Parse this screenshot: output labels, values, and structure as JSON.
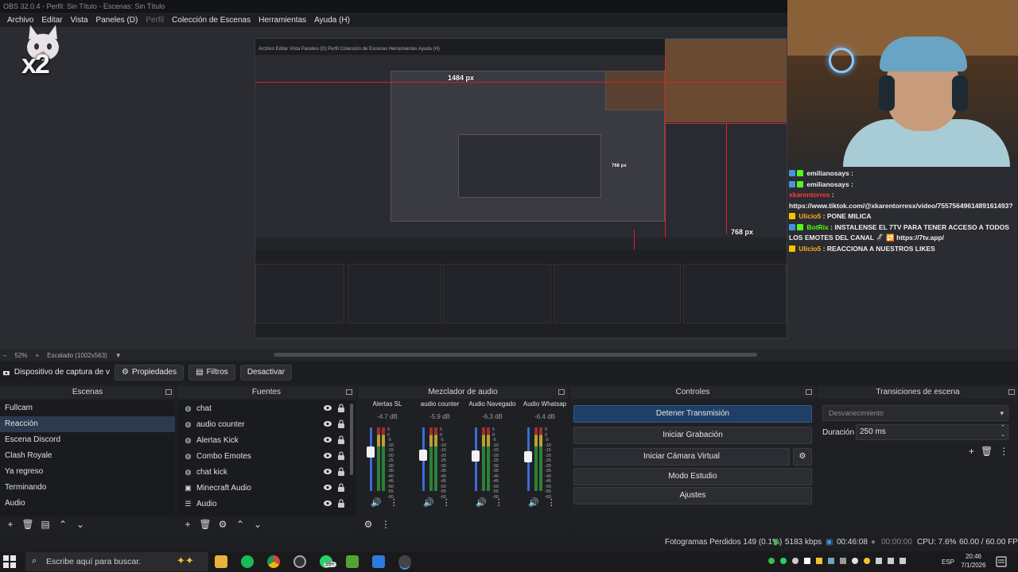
{
  "window": {
    "title": "OBS 32.0.4 - Perfil: Sin Título - Escenas: Sin Título"
  },
  "menu": [
    "Archivo",
    "Editar",
    "Vista",
    "Paneles (D)",
    "Perfil",
    "Colección de Escenas",
    "Herramientas",
    "Ayuda (H)"
  ],
  "overlay": {
    "multiplier": "x2"
  },
  "preview": {
    "labels": {
      "width": "1484 px",
      "height_top": "768 px",
      "height_bottom": "768 px"
    }
  },
  "chat": {
    "lines": [
      {
        "user": "emilianosays",
        "text": ""
      },
      {
        "user": "emilianosays",
        "text": ""
      },
      {
        "user": "xkarentorres",
        "text": "https://www.tiktok.com/@xkarentorresx/video/7557564961489161493?"
      },
      {
        "user": "Ulicio5",
        "text": "PONE MILICA"
      },
      {
        "user": "BotRix",
        "text": "INSTALENSE EL 7TV PARA TENER ACCESO A TODOS LOS EMOTES DEL CANAL 🦨 🔁 https://7tv.app/"
      },
      {
        "user": "Ulicio5",
        "text": "REACCIONA A NUESTROS LIKES"
      }
    ]
  },
  "zoom": {
    "percent": "52%",
    "scale": "Escalado (1002x563)"
  },
  "source_toolbar": {
    "source_name": "Dispositivo de captura de v",
    "properties": "Propiedades",
    "filters": "Filtros",
    "deactivate": "Desactivar"
  },
  "scenes": {
    "title": "Escenas",
    "items": [
      "Fullcam",
      "Reacción",
      "Escena Discord",
      "Clash Royale",
      "Ya regreso",
      "Terminando",
      "Audio"
    ],
    "selected": "Reacción"
  },
  "sources": {
    "title": "Fuentes",
    "items": [
      {
        "name": "chat",
        "icon": "globe-icon"
      },
      {
        "name": "audio counter",
        "icon": "globe-icon"
      },
      {
        "name": "Alertas Kick",
        "icon": "globe-icon"
      },
      {
        "name": "Combo Emotes",
        "icon": "globe-icon"
      },
      {
        "name": "chat kick",
        "icon": "globe-icon"
      },
      {
        "name": "Minecraft Audio",
        "icon": "display-icon"
      },
      {
        "name": "Audio",
        "icon": "list-icon"
      }
    ]
  },
  "mixer": {
    "title": "Mezclador de audio",
    "scale": [
      "5",
      "0",
      "-5",
      "-10",
      "-15",
      "-20",
      "-25",
      "-30",
      "-35",
      "-40",
      "-45",
      "-50",
      "-55",
      "-60"
    ],
    "channels": [
      {
        "name": "Alertas SL",
        "db": "-4.7 dB",
        "level": 0.7,
        "muted": false
      },
      {
        "name": "audio counter",
        "db": "-5.9 dB",
        "level": 0.65,
        "muted": false
      },
      {
        "name": "Audio Navegado",
        "db": "-6.3 dB",
        "level": 0.64,
        "muted": false
      },
      {
        "name": "Audio Whatsap",
        "db": "-6.4 dB",
        "level": 0.63,
        "muted": true
      }
    ]
  },
  "controls": {
    "title": "Controles",
    "stop_stream": "Detener Transmisión",
    "start_recording": "Iniciar Grabación",
    "start_virtual_cam": "Iniciar Cámara Virtual",
    "studio_mode": "Modo Estudio",
    "settings": "Ajustes"
  },
  "transitions": {
    "title": "Transiciones de escena",
    "selected": "Desvanecimiento",
    "duration_label": "Duración",
    "duration": "250 ms"
  },
  "status": {
    "dropped_frames": "Fotogramas Perdidos 149 (0.1%)",
    "bitrate": "5183 kbps",
    "stream_time": "00:46:08",
    "rec_time": "00:00:00",
    "cpu": "CPU: 7.6%",
    "fps": "60.00 / 60.00 FPS"
  },
  "taskbar": {
    "search_placeholder": "Escribe aquí para buscar.",
    "lang": "ESP",
    "time": "20:46",
    "date": "7/1/2026",
    "badge": "99+"
  },
  "colors": {
    "accent": "#2b3a4e",
    "stream_active": "#1f3f66",
    "guide_red": "#e02020"
  }
}
